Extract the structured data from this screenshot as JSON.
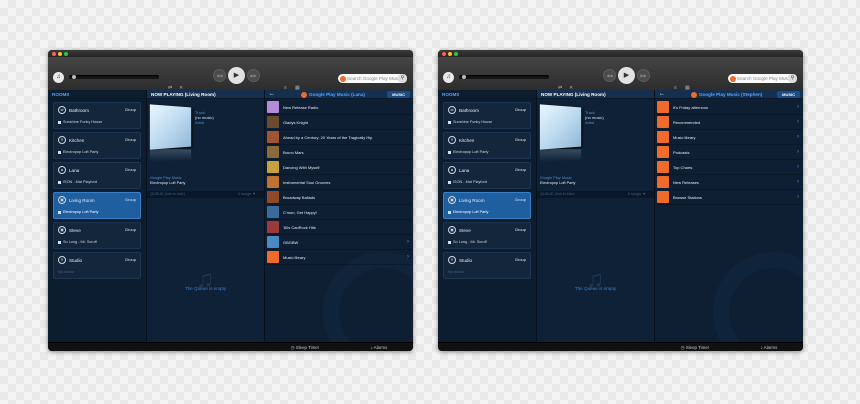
{
  "windows": [
    {
      "search_placeholder": "Search Google Play Music",
      "rooms_header": "ROOMS",
      "nowplaying_header": "NOW PLAYING (Living Room)",
      "rooms": [
        {
          "name": "Bathroom",
          "group": "Group",
          "track": "Sunshine Funky House",
          "active": false
        },
        {
          "name": "Kitchen",
          "group": "Group",
          "track": "Electropop Loft Party",
          "active": false
        },
        {
          "name": "Lana",
          "group": "Group",
          "track": "ISON - Mat Playford",
          "active": false
        },
        {
          "name": "Living Room",
          "group": "Group",
          "track": "Electropop Loft Party",
          "active": true
        },
        {
          "name": "Steve",
          "group": "Group",
          "track": "So Long - Mr. Scruff",
          "active": false
        },
        {
          "name": "Studio",
          "group": "Group",
          "track": "No music",
          "active": false
        }
      ],
      "np_line1": "Track",
      "np_line2": "(no music)",
      "np_line3": "Artist",
      "np_source": "Google Play Music",
      "np_station": "Electropop Loft Party",
      "queue_label": "QUEUE (Not in Use)",
      "queue_info": "0 songs",
      "queue_empty": "The Queue is empty",
      "music_title": "Google Play Music (Lana)",
      "music_button": "MUSIC",
      "music_items": [
        {
          "label": "New Release Radio",
          "thumb": "#b58bd8",
          "chev": false
        },
        {
          "label": "Gladys Knight",
          "thumb": "#6a4b2e",
          "chev": false
        },
        {
          "label": "Ahead by a Century: 20 Years of the Tragically Hip",
          "thumb": "#a05530",
          "chev": false
        },
        {
          "label": "Bruno Mars",
          "thumb": "#8a6a3a",
          "chev": false
        },
        {
          "label": "Dancing With Myself",
          "thumb": "#c9a040",
          "chev": false
        },
        {
          "label": "Instrumental Soul Grooves",
          "thumb": "#c07030",
          "chev": false
        },
        {
          "label": "Broadway Ballads",
          "thumb": "#904a2a",
          "chev": false
        },
        {
          "label": "C'mon, Get Happy!",
          "thumb": "#3a6a9a",
          "chev": false
        },
        {
          "label": "'80s CanRock Hits",
          "thumb": "#9a3a3a",
          "chev": false
        },
        {
          "label": "GBGBW",
          "thumb": "#4a8ac0",
          "chev": true
        },
        {
          "label": "Music library",
          "thumb": "#f06a2c",
          "chev": true
        }
      ],
      "sleep_timer": "Sleep Timer",
      "alarms": "Alarms"
    },
    {
      "search_placeholder": "Search Google Play Music",
      "rooms_header": "ROOMS",
      "nowplaying_header": "NOW PLAYING (Living Room)",
      "rooms": [
        {
          "name": "Bathroom",
          "group": "Group",
          "track": "Sunshine Funky House",
          "active": false
        },
        {
          "name": "Kitchen",
          "group": "Group",
          "track": "Electropop Loft Party",
          "active": false
        },
        {
          "name": "Lana",
          "group": "Group",
          "track": "ISON - Mat Playford",
          "active": false
        },
        {
          "name": "Living Room",
          "group": "Group",
          "track": "Electropop Loft Party",
          "active": true
        },
        {
          "name": "Steve",
          "group": "Group",
          "track": "So Long - Mr. Scruff",
          "active": false
        },
        {
          "name": "Studio",
          "group": "Group",
          "track": "No music",
          "active": false
        }
      ],
      "np_line1": "Track",
      "np_line2": "(no music)",
      "np_line3": "Artist",
      "np_source": "Google Play Music",
      "np_station": "Electropop Loft Party",
      "queue_label": "QUEUE (Not in Use)",
      "queue_info": "0 songs",
      "queue_empty": "The Queue is empty",
      "music_title": "Google Play Music (Stephen)",
      "music_button": "MUSIC",
      "music_items": [
        {
          "label": "It's Friday afternoon",
          "thumb": "#f06a2c",
          "chev": true
        },
        {
          "label": "Recommended",
          "thumb": "#f06a2c",
          "chev": true
        },
        {
          "label": "Music library",
          "thumb": "#f06a2c",
          "chev": true
        },
        {
          "label": "Podcasts",
          "thumb": "#f06a2c",
          "chev": true
        },
        {
          "label": "Top Charts",
          "thumb": "#f06a2c",
          "chev": true
        },
        {
          "label": "New Releases",
          "thumb": "#f06a2c",
          "chev": true
        },
        {
          "label": "Browse Stations",
          "thumb": "#f06a2c",
          "chev": true
        }
      ],
      "sleep_timer": "Sleep Timer",
      "alarms": "Alarms"
    }
  ]
}
